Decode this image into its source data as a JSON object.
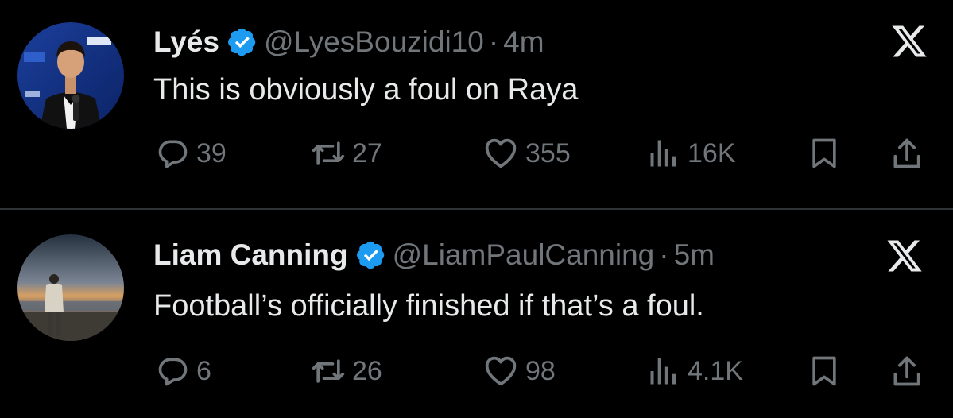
{
  "tweets": [
    {
      "name": "Lyés",
      "handle": "@LyesBouzidi10",
      "separator": "·",
      "time": "4m",
      "text": "This is obviously a foul on Raya",
      "replies": "39",
      "reposts": "27",
      "likes": "355",
      "views": "16K"
    },
    {
      "name": "Liam Canning",
      "handle": "@LiamPaulCanning",
      "separator": "·",
      "time": "5m",
      "text": "Football’s officially finished if that’s a foul.",
      "replies": "6",
      "reposts": "26",
      "likes": "98",
      "views": "4.1K"
    }
  ],
  "colors": {
    "background": "#000000",
    "text": "#e7e9ea",
    "muted": "#71767b",
    "verified": "#1d9bf0",
    "divider": "#2f3336"
  },
  "icons": [
    "verified-badge-icon",
    "x-logo-icon",
    "reply-icon",
    "repost-icon",
    "like-icon",
    "views-icon",
    "bookmark-icon",
    "share-icon"
  ]
}
